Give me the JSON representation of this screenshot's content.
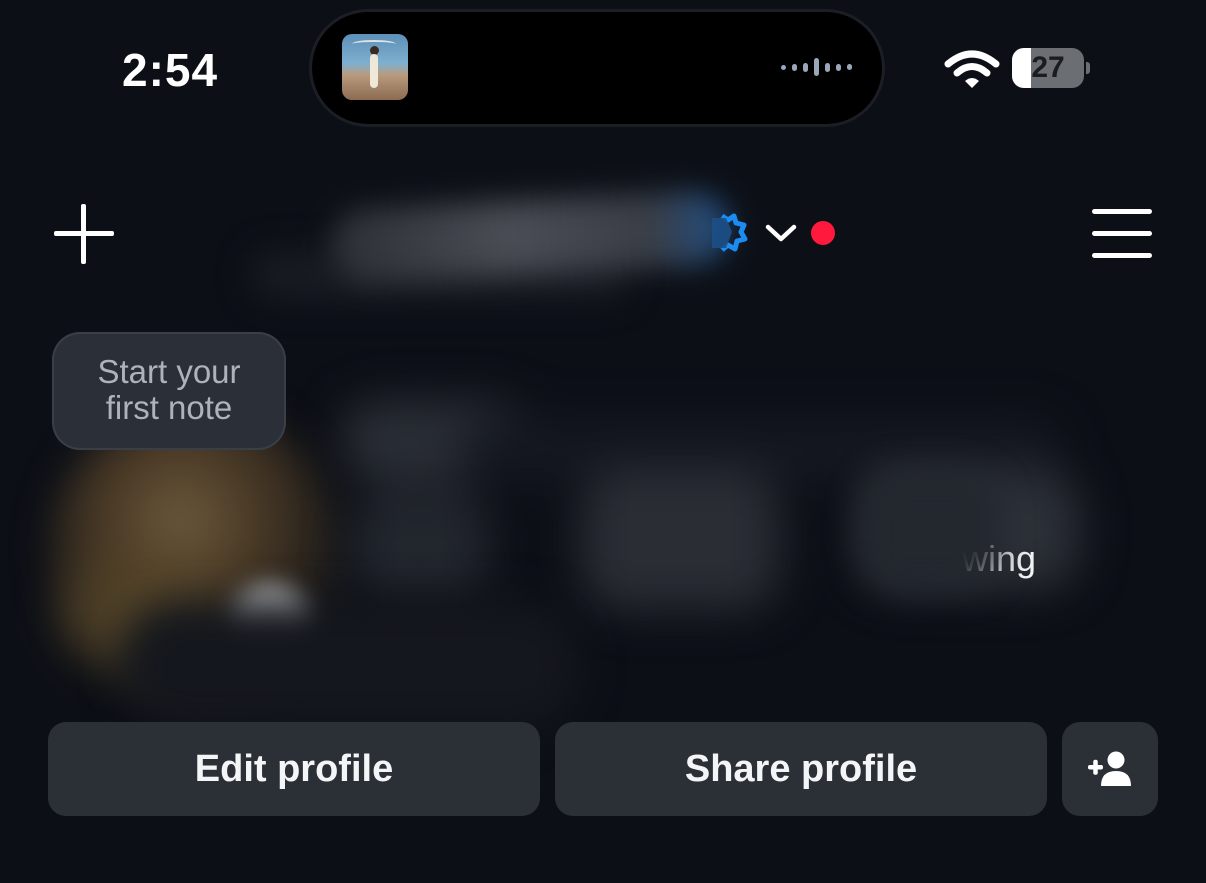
{
  "status_bar": {
    "time": "2:54",
    "battery_percent": "27",
    "battery_level": 0.27,
    "icons": [
      "wifi-icon",
      "battery-icon"
    ]
  },
  "dynamic_island": {
    "activity": "now-playing",
    "icons": [
      "album-art-thumbnail",
      "audio-waveform-icon"
    ]
  },
  "header": {
    "left_icon": "plus-icon",
    "right_icon": "hamburger-menu-icon",
    "username_blurred": true,
    "icons": [
      "verified-badge-icon",
      "chevron-down-icon"
    ],
    "notification_dot_color": "#ff1a3d",
    "verified_color": "#1d8cf0"
  },
  "profile": {
    "note_prompt": "Start your first note",
    "following_visible_fragment": "wing",
    "details_blurred": true
  },
  "actions": {
    "edit_profile": "Edit profile",
    "share_profile": "Share profile",
    "discover_icon": "add-person-icon"
  },
  "colors": {
    "background": "#0c0f16",
    "button_bg": "#2b2f36",
    "text": "#f4f5f7"
  }
}
